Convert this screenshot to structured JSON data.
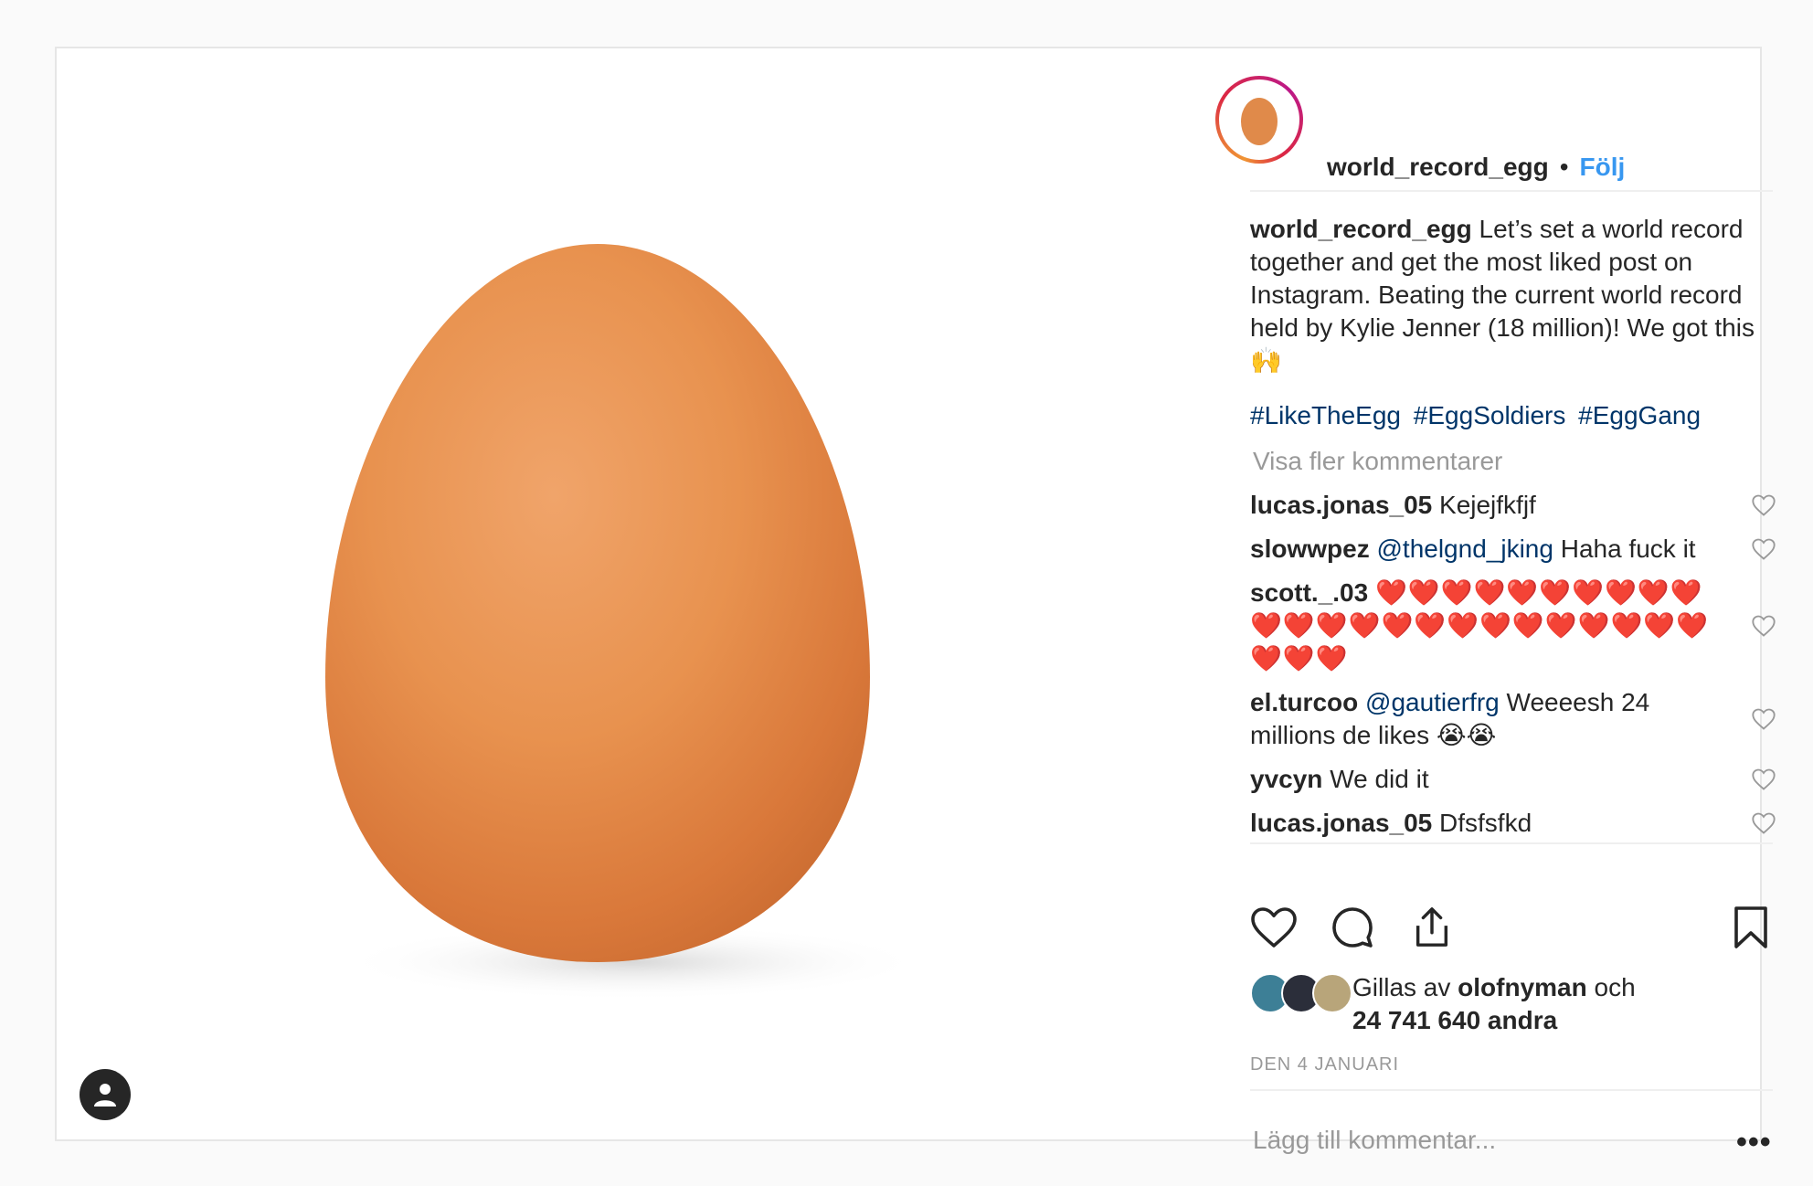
{
  "colors": {
    "accent": "#3897f0",
    "tag": "#003569",
    "muted": "#999999",
    "heart": "#ed4956"
  },
  "header": {
    "username": "world_record_egg",
    "separator": "•",
    "follow_label": "Följ"
  },
  "caption": {
    "username": "world_record_egg",
    "text": "Let’s set a world record together and get the most liked post on Instagram. Beating the current world record held by Kylie Jenner (18 million)! We got this 🙌",
    "hashtags": [
      "#LikeTheEgg",
      "#EggSoldiers",
      "#EggGang"
    ]
  },
  "view_more_label": "Visa fler kommentarer",
  "comments": [
    {
      "user": "lucas.jonas_05",
      "mention": "",
      "text": "Kejejfkfjf"
    },
    {
      "user": "slowwpez",
      "mention": "@thelgnd_jking",
      "text": "Haha fuck it"
    },
    {
      "user": "scott._.03",
      "mention": "",
      "text": "❤️❤️❤️❤️❤️❤️❤️❤️❤️❤️❤️❤️❤️❤️❤️❤️❤️❤️❤️❤️❤️❤️❤️❤️❤️❤️❤️"
    },
    {
      "user": "el.turcoo",
      "mention": "@gautierfrg",
      "text": "Weeeesh 24 millions de likes 😭😭"
    },
    {
      "user": "yvcyn",
      "mention": "",
      "text": "We did it"
    },
    {
      "user": "lucas.jonas_05",
      "mention": "",
      "text": "Dfsfsfkd"
    }
  ],
  "actions": {
    "like_icon": "heart-icon",
    "comment_icon": "comment-icon",
    "share_icon": "share-icon",
    "save_icon": "bookmark-icon"
  },
  "likes": {
    "prefix": "Gillas av",
    "first_user": "olofnyman",
    "conjunction": "och",
    "count_text": "24 741 640 andra"
  },
  "date": "DEN 4 JANUARI",
  "add_comment_placeholder": "Lägg till kommentar...",
  "more_options_label": "•••"
}
